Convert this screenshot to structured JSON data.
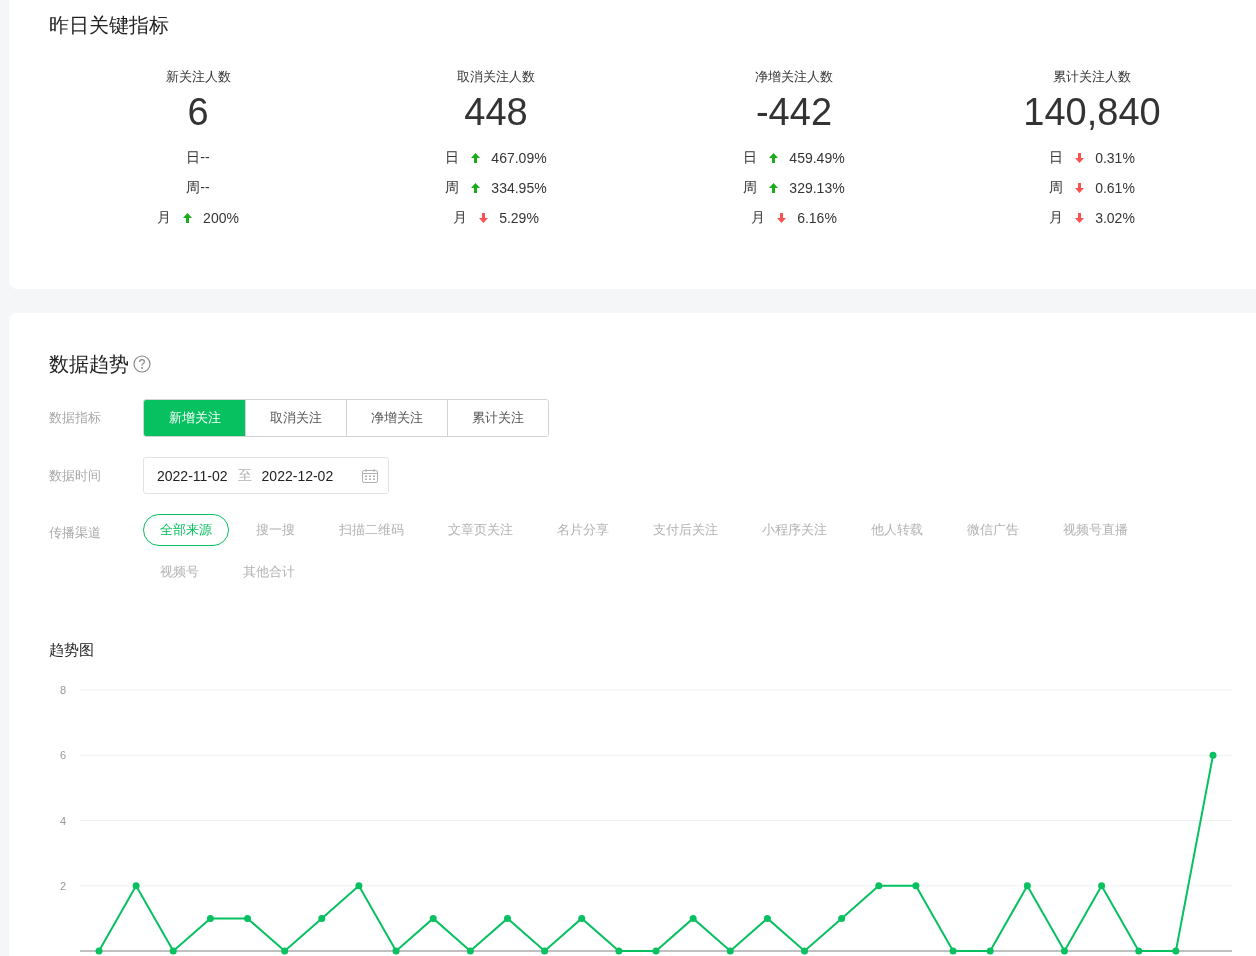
{
  "key_metrics": {
    "title": "昨日关键指标",
    "metrics": [
      {
        "label": "新关注人数",
        "value": "6",
        "changes": [
          {
            "label": "日--"
          },
          {
            "label": "周--"
          },
          {
            "label": "月",
            "up": true,
            "value": "200%"
          }
        ]
      },
      {
        "label": "取消关注人数",
        "value": "448",
        "changes": [
          {
            "label": "日",
            "up": true,
            "value": "467.09%"
          },
          {
            "label": "周",
            "up": true,
            "value": "334.95%"
          },
          {
            "label": "月",
            "up": false,
            "value": "5.29%"
          }
        ]
      },
      {
        "label": "净增关注人数",
        "value": "-442",
        "changes": [
          {
            "label": "日",
            "up": true,
            "value": "459.49%"
          },
          {
            "label": "周",
            "up": true,
            "value": "329.13%"
          },
          {
            "label": "月",
            "up": false,
            "value": "6.16%"
          }
        ]
      },
      {
        "label": "累计关注人数",
        "value": "140,840",
        "changes": [
          {
            "label": "日",
            "up": false,
            "value": "0.31%"
          },
          {
            "label": "周",
            "up": false,
            "value": "0.61%"
          },
          {
            "label": "月",
            "up": false,
            "value": "3.02%"
          }
        ]
      }
    ]
  },
  "trend": {
    "title": "数据趋势",
    "indicator": {
      "label": "数据指标",
      "options": [
        {
          "label": "新增关注",
          "selected": true
        },
        {
          "label": "取消关注",
          "selected": false
        },
        {
          "label": "净增关注",
          "selected": false
        },
        {
          "label": "累计关注",
          "selected": false
        }
      ]
    },
    "date_range": {
      "label": "数据时间",
      "start": "2022-11-02",
      "separator": "至",
      "end": "2022-12-02"
    },
    "channels": {
      "label": "传播渠道",
      "options": [
        {
          "label": "全部来源",
          "selected": true
        },
        {
          "label": "搜一搜",
          "selected": false
        },
        {
          "label": "扫描二维码",
          "selected": false
        },
        {
          "label": "文章页关注",
          "selected": false
        },
        {
          "label": "名片分享",
          "selected": false
        },
        {
          "label": "支付后关注",
          "selected": false
        },
        {
          "label": "小程序关注",
          "selected": false
        },
        {
          "label": "他人转载",
          "selected": false
        },
        {
          "label": "微信广告",
          "selected": false
        },
        {
          "label": "视频号直播",
          "selected": false
        },
        {
          "label": "视频号",
          "selected": false
        },
        {
          "label": "其他合计",
          "selected": false
        }
      ]
    },
    "chart_title": "趋势图",
    "chart_data": {
      "type": "line",
      "grid": true,
      "ylim": [
        0,
        8
      ],
      "yticks": [
        2,
        4,
        6,
        8
      ],
      "series": [
        {
          "color": "#07c160",
          "marker": "circle",
          "values": [
            0,
            2,
            0,
            1,
            1,
            0,
            1,
            2,
            0,
            1,
            0,
            1,
            0,
            1,
            0,
            0,
            1,
            0,
            1,
            0,
            1,
            2,
            2,
            0,
            0,
            2,
            0,
            2,
            0,
            0,
            6
          ]
        }
      ]
    }
  }
}
